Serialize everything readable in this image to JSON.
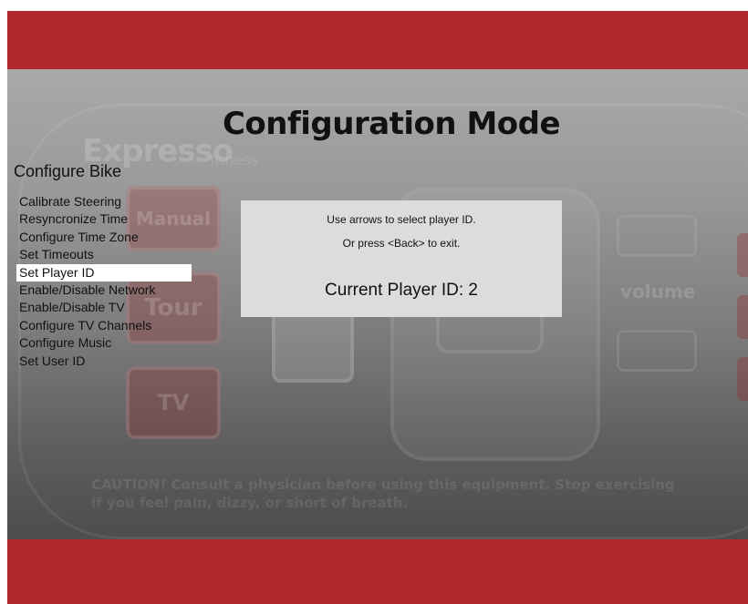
{
  "title": "Configuration Mode",
  "menu": {
    "heading": "Configure Bike",
    "selected_index": 4,
    "items": [
      {
        "label": "Calibrate Steering"
      },
      {
        "label": "Resyncronize Time"
      },
      {
        "label": "Configure Time Zone"
      },
      {
        "label": "Set Timeouts"
      },
      {
        "label": "Set Player ID"
      },
      {
        "label": "Enable/Disable Network"
      },
      {
        "label": "Enable/Disable TV"
      },
      {
        "label": "Configure TV Channels"
      },
      {
        "label": "Configure Music"
      },
      {
        "label": "Set User ID"
      }
    ]
  },
  "dialog": {
    "line1": "Use arrows to select player ID.",
    "line2": "Or press <Back> to exit.",
    "player_id_text": "Current Player ID: 2"
  },
  "background": {
    "brand": "Expresso",
    "brand_sub": "fitness",
    "buttons": {
      "manual": "Manual",
      "tour": "Tour",
      "tv": "TV"
    },
    "volume_label": "volume",
    "caution": "CAUTION! Consult a physician before using this equipment. Stop exercising if you feel pain, dizzy, or short of breath."
  },
  "colors": {
    "band": "#b1282c",
    "dialog_bg": "#dcdcdc",
    "selection_bg": "#ffffff"
  }
}
